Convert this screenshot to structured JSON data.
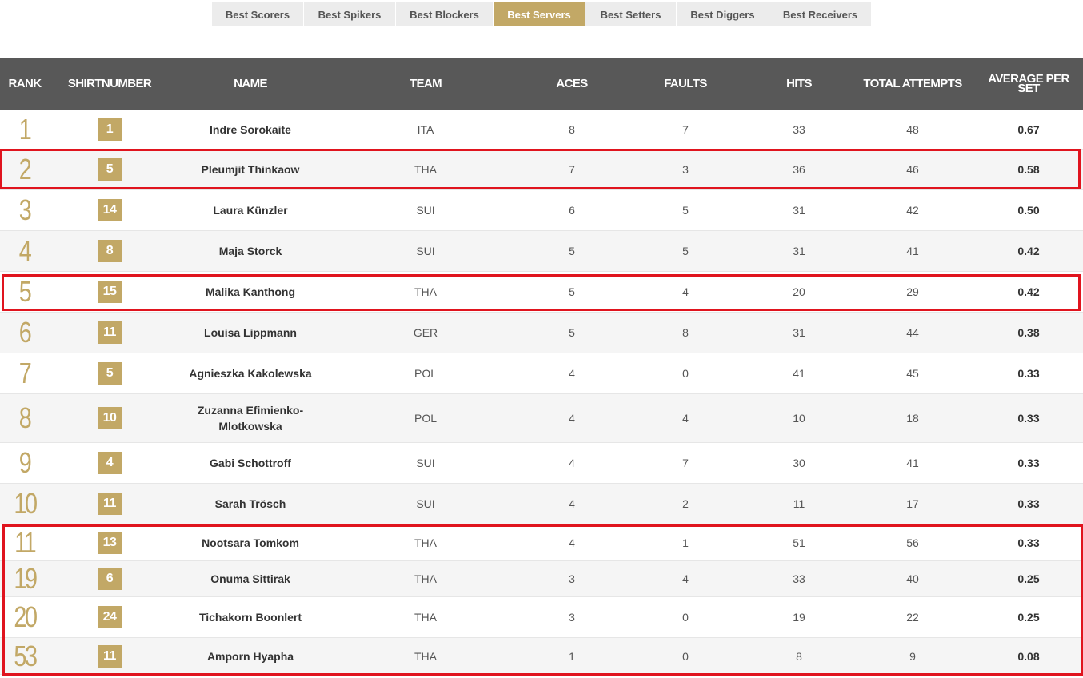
{
  "tabs": [
    {
      "label": "Best Scorers",
      "active": false
    },
    {
      "label": "Best Spikers",
      "active": false
    },
    {
      "label": "Best Blockers",
      "active": false
    },
    {
      "label": "Best Servers",
      "active": true
    },
    {
      "label": "Best Setters",
      "active": false
    },
    {
      "label": "Best Diggers",
      "active": false
    },
    {
      "label": "Best Receivers",
      "active": false
    }
  ],
  "table": {
    "headers": {
      "rank": "RANK",
      "shirt": "SHIRTNUMBER",
      "name": "NAME",
      "team": "TEAM",
      "aces": "ACES",
      "faults": "FAULTS",
      "hits": "HITS",
      "attempts": "TOTAL ATTEMPTS",
      "avg": "AVERAGE PER SET"
    },
    "rows": [
      {
        "rank": "1",
        "shirt": "1",
        "name": "Indre Sorokaite",
        "team": "ITA",
        "aces": "8",
        "faults": "7",
        "hits": "33",
        "attempts": "48",
        "avg": "0.67"
      },
      {
        "rank": "2",
        "shirt": "5",
        "name": "Pleumjit Thinkaow",
        "team": "THA",
        "aces": "7",
        "faults": "3",
        "hits": "36",
        "attempts": "46",
        "avg": "0.58"
      },
      {
        "rank": "3",
        "shirt": "14",
        "name": "Laura Künzler",
        "team": "SUI",
        "aces": "6",
        "faults": "5",
        "hits": "31",
        "attempts": "42",
        "avg": "0.50"
      },
      {
        "rank": "4",
        "shirt": "8",
        "name": "Maja Storck",
        "team": "SUI",
        "aces": "5",
        "faults": "5",
        "hits": "31",
        "attempts": "41",
        "avg": "0.42"
      },
      {
        "rank": "5",
        "shirt": "15",
        "name": "Malika Kanthong",
        "team": "THA",
        "aces": "5",
        "faults": "4",
        "hits": "20",
        "attempts": "29",
        "avg": "0.42"
      },
      {
        "rank": "6",
        "shirt": "11",
        "name": "Louisa Lippmann",
        "team": "GER",
        "aces": "5",
        "faults": "8",
        "hits": "31",
        "attempts": "44",
        "avg": "0.38"
      },
      {
        "rank": "7",
        "shirt": "5",
        "name": "Agnieszka Kakolewska",
        "team": "POL",
        "aces": "4",
        "faults": "0",
        "hits": "41",
        "attempts": "45",
        "avg": "0.33"
      },
      {
        "rank": "8",
        "shirt": "10",
        "name": "Zuzanna Efimienko-Mlotkowska",
        "team": "POL",
        "aces": "4",
        "faults": "4",
        "hits": "10",
        "attempts": "18",
        "avg": "0.33"
      },
      {
        "rank": "9",
        "shirt": "4",
        "name": "Gabi Schottroff",
        "team": "SUI",
        "aces": "4",
        "faults": "7",
        "hits": "30",
        "attempts": "41",
        "avg": "0.33"
      },
      {
        "rank": "10",
        "shirt": "11",
        "name": "Sarah Trösch",
        "team": "SUI",
        "aces": "4",
        "faults": "2",
        "hits": "11",
        "attempts": "17",
        "avg": "0.33"
      },
      {
        "rank": "11",
        "shirt": "13",
        "name": "Nootsara Tomkom",
        "team": "THA",
        "aces": "4",
        "faults": "1",
        "hits": "51",
        "attempts": "56",
        "avg": "0.33"
      },
      {
        "rank": "19",
        "shirt": "6",
        "name": "Onuma Sittirak",
        "team": "THA",
        "aces": "3",
        "faults": "4",
        "hits": "33",
        "attempts": "40",
        "avg": "0.25"
      },
      {
        "rank": "20",
        "shirt": "24",
        "name": "Tichakorn Boonlert",
        "team": "THA",
        "aces": "3",
        "faults": "0",
        "hits": "19",
        "attempts": "22",
        "avg": "0.25"
      },
      {
        "rank": "53",
        "shirt": "11",
        "name": "Amporn Hyapha",
        "team": "THA",
        "aces": "1",
        "faults": "0",
        "hits": "8",
        "attempts": "9",
        "avg": "0.08"
      }
    ]
  },
  "colors": {
    "accent": "#c2a866",
    "header_bg": "#585858",
    "highlight": "#e0141e"
  }
}
